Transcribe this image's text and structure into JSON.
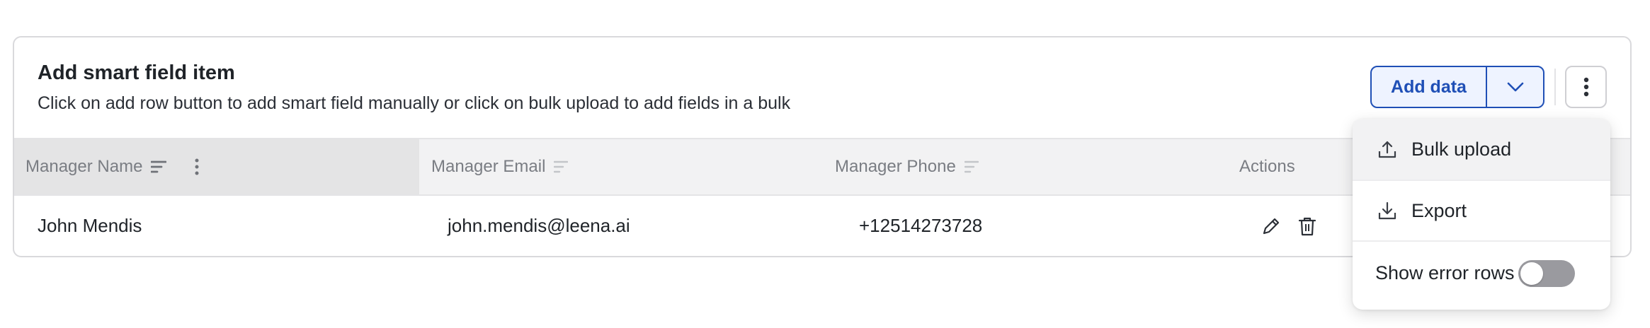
{
  "card": {
    "title": "Add smart field item",
    "subtitle": "Click on add row button to add smart field manually or click on bulk upload to add fields in a bulk"
  },
  "toolbar": {
    "add_data_label": "Add data",
    "caret_icon": "chevron-down-icon",
    "more_icon": "kebab-vertical-icon"
  },
  "table": {
    "columns": [
      {
        "label": "Manager Name",
        "sort_icon": "sort-lines-icon",
        "has_menu": true
      },
      {
        "label": "Manager Email",
        "sort_icon": "sort-lines-icon"
      },
      {
        "label": "Manager Phone",
        "sort_icon": "sort-lines-icon"
      },
      {
        "label": "Actions"
      }
    ],
    "rows": [
      {
        "name": "John Mendis",
        "email": "john.mendis@leena.ai",
        "phone": "+12514273728"
      }
    ]
  },
  "dropdown": {
    "items": [
      {
        "label": "Bulk upload",
        "icon": "upload-icon",
        "active": true
      },
      {
        "label": "Export",
        "icon": "download-icon",
        "active": false
      }
    ],
    "toggle": {
      "label": "Show error rows",
      "checked": false
    }
  },
  "colors": {
    "accent": "#1f4fb6",
    "accent_bg": "#eef3ff",
    "header_bg": "#f2f2f3",
    "toggle_off": "#9a9a9f"
  }
}
